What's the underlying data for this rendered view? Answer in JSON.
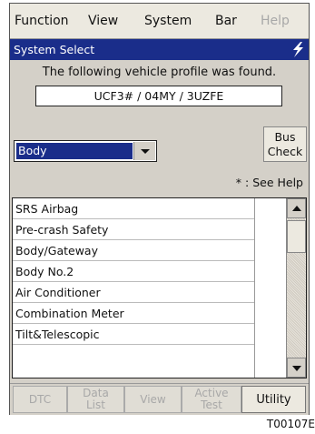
{
  "menu": {
    "items": [
      {
        "label": "Function",
        "enabled": true
      },
      {
        "label": "View",
        "enabled": true
      },
      {
        "label": "System",
        "enabled": true
      },
      {
        "label": "Bar",
        "enabled": true
      },
      {
        "label": "Help",
        "enabled": false
      }
    ]
  },
  "title_bar": {
    "title": "System Select",
    "icon": "lightning-bolt-icon"
  },
  "profile": {
    "message": "The following vehicle profile was found.",
    "value": "UCF3#   / 04MY / 3UZFE"
  },
  "system_dropdown": {
    "selected": "Body"
  },
  "bus_check": {
    "line1": "Bus",
    "line2": "Check"
  },
  "see_help": "* : See Help",
  "systems": [
    "SRS Airbag",
    "Pre-crash Safety",
    "Body/Gateway",
    "Body No.2",
    "Air Conditioner",
    "Combination Meter",
    "Tilt&Telescopic"
  ],
  "tabs": {
    "dtc": "DTC",
    "data_list_1": "Data",
    "data_list_2": "List",
    "view": "View",
    "active_test_1": "Active",
    "active_test_2": "Test",
    "utility": "Utility"
  },
  "figure_id": "T00107E",
  "colors": {
    "title_bar": "#1a2d8a",
    "selection": "#1a2d8a",
    "disabled_text": "#a8a8a8"
  }
}
